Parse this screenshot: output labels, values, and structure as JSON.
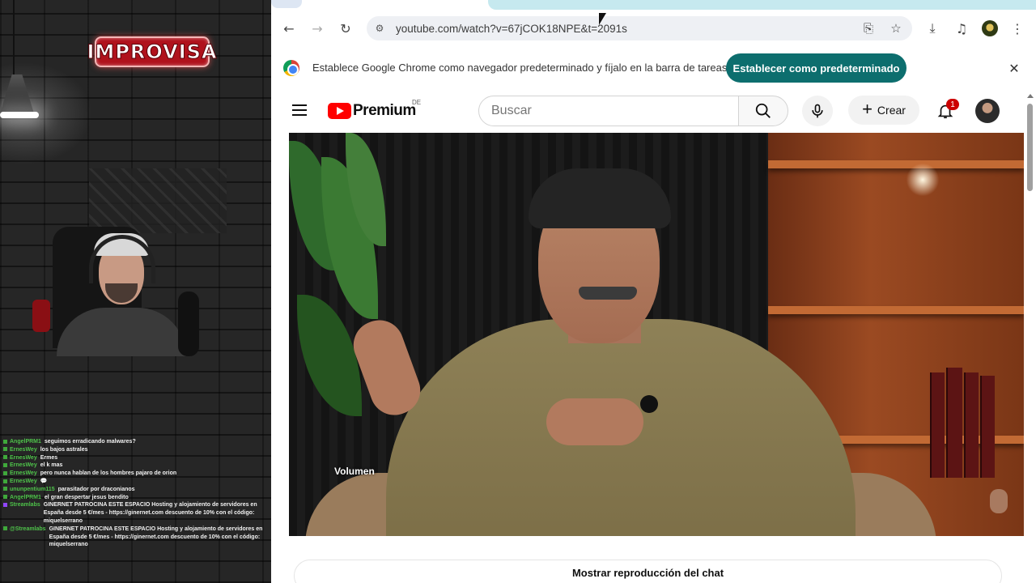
{
  "overlay": {
    "logo_text": "IMPROVISA",
    "chat": [
      {
        "user": "AngelPRM1",
        "message": "seguimos erradicando malwares?",
        "badge": "green"
      },
      {
        "user": "ErnesWey",
        "message": "los bajos astrales",
        "badge": "green"
      },
      {
        "user": "ErnesWey",
        "message": "Ermes",
        "badge": "green"
      },
      {
        "user": "ErnesWey",
        "message": "el k mas",
        "badge": "green"
      },
      {
        "user": "ErnesWey",
        "message": "pero nunca hablan de los hombres pajaro de orion",
        "badge": "green"
      },
      {
        "user": "ErnesWey",
        "message": "💬",
        "badge": "green"
      },
      {
        "user": "ununpentium115",
        "message": "parasitador por draconianos",
        "badge": "green"
      },
      {
        "user": "AngelPRM1",
        "message": "el gran despertar jesus bendito",
        "badge": "green"
      },
      {
        "user": "Streamlabs",
        "message": "GINERNET PATROCINA ESTE ESPACIO Hosting y alojamiento de servidores en España desde 5 €/mes - https://ginernet.com descuento de 10% con el código: miquelserrano",
        "badge": "purple"
      },
      {
        "user": "@Streamlabs",
        "message": "GINERNET PATROCINA ESTE ESPACIO Hosting y alojamiento de servidores en España desde 5 €/mes - https://ginernet.com descuento de 10% con el código: miquelserrano",
        "badge": "green"
      }
    ]
  },
  "browser": {
    "url": "youtube.com/watch?v=67jCOK18NPE&t=2091s",
    "infobar": {
      "message": "Establece Google Chrome como navegador predeterminado y fíjalo en la barra de tareas",
      "button_label": "Establecer como predeterminado"
    }
  },
  "youtube": {
    "logo_text": "Premium",
    "region": "DE",
    "search_placeholder": "Buscar",
    "create_label": "Crear",
    "notification_count": "1",
    "player": {
      "volume_label": "Volumen"
    },
    "chat_replay_label": "Mostrar reproducción del chat"
  },
  "colors": {
    "accent_teal": "#0d6e6e",
    "youtube_red": "#ff0000",
    "chat_username": "#4ec24a"
  },
  "icons": {
    "toolbar": [
      "back-arrow-icon",
      "forward-arrow-icon",
      "reload-icon",
      "site-info-icon",
      "install-app-icon",
      "bookmark-star-icon",
      "download-icon",
      "media-controls-icon",
      "profile-icon",
      "kebab-menu-icon"
    ],
    "youtube": [
      "hamburger-menu-icon",
      "search-icon",
      "microphone-icon",
      "plus-icon",
      "bell-icon"
    ]
  }
}
